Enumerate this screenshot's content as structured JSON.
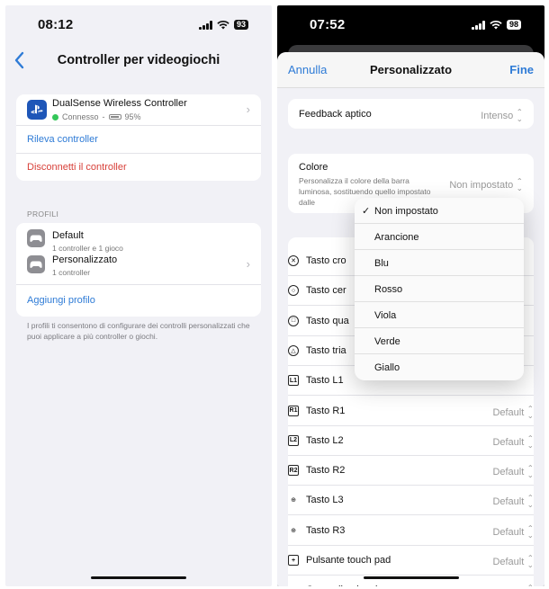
{
  "left": {
    "status": {
      "time": "08:12",
      "battery": "93"
    },
    "nav": {
      "title": "Controller per videogiochi"
    },
    "controller": {
      "name": "DualSense Wireless Controller",
      "state": "Connesso",
      "separator": "-",
      "battery": "95%",
      "detect": "Rileva controller",
      "disconnect": "Disconnetti il controller"
    },
    "profiles": {
      "header": "PROFILI",
      "items": [
        {
          "name": "Default",
          "sub": "1 controller e 1 gioco"
        },
        {
          "name": "Personalizzato",
          "sub": "1 controller"
        }
      ],
      "add": "Aggiungi profilo",
      "footnote": "I profili ti consentono di configurare dei controlli personalizzati che puoi applicare a più controller o giochi."
    }
  },
  "right": {
    "status": {
      "time": "07:52",
      "battery": "98"
    },
    "sheet": {
      "cancel": "Annulla",
      "title": "Personalizzato",
      "done": "Fine"
    },
    "haptic": {
      "label": "Feedback aptico",
      "value": "Intenso"
    },
    "color": {
      "label": "Colore",
      "description": "Personalizza il colore della barra luminosa, sostituendo quello impostato dalle",
      "value": "Non impostato"
    },
    "buttons": [
      {
        "label": "Tasto cro",
        "value": "",
        "icon": "cross"
      },
      {
        "label": "Tasto cer",
        "value": "",
        "icon": "circle"
      },
      {
        "label": "Tasto qua",
        "value": "",
        "icon": "square"
      },
      {
        "label": "Tasto tria",
        "value": "",
        "icon": "triangle"
      },
      {
        "label": "Tasto L1",
        "value": "",
        "icon": "L1"
      },
      {
        "label": "Tasto R1",
        "value": "Default",
        "icon": "R1"
      },
      {
        "label": "Tasto L2",
        "value": "Default",
        "icon": "L2"
      },
      {
        "label": "Tasto R2",
        "value": "Default",
        "icon": "R2"
      },
      {
        "label": "Tasto L3",
        "value": "Default",
        "icon": "L3"
      },
      {
        "label": "Tasto R3",
        "value": "Default",
        "icon": "R3"
      },
      {
        "label": "Pulsante touch pad",
        "value": "Default",
        "icon": "touchpad"
      },
      {
        "label": "Croce direzionale",
        "value": "Default",
        "icon": "dpad"
      }
    ],
    "color_menu": {
      "selected_mark": "✓",
      "options": [
        "Non impostato",
        "Arancione",
        "Blu",
        "Rosso",
        "Viola",
        "Verde",
        "Giallo"
      ]
    }
  },
  "colors": {
    "accent": "#2e7bd6",
    "danger": "#d8413a",
    "connected": "#34c759",
    "playstation": "#1e56b8"
  }
}
